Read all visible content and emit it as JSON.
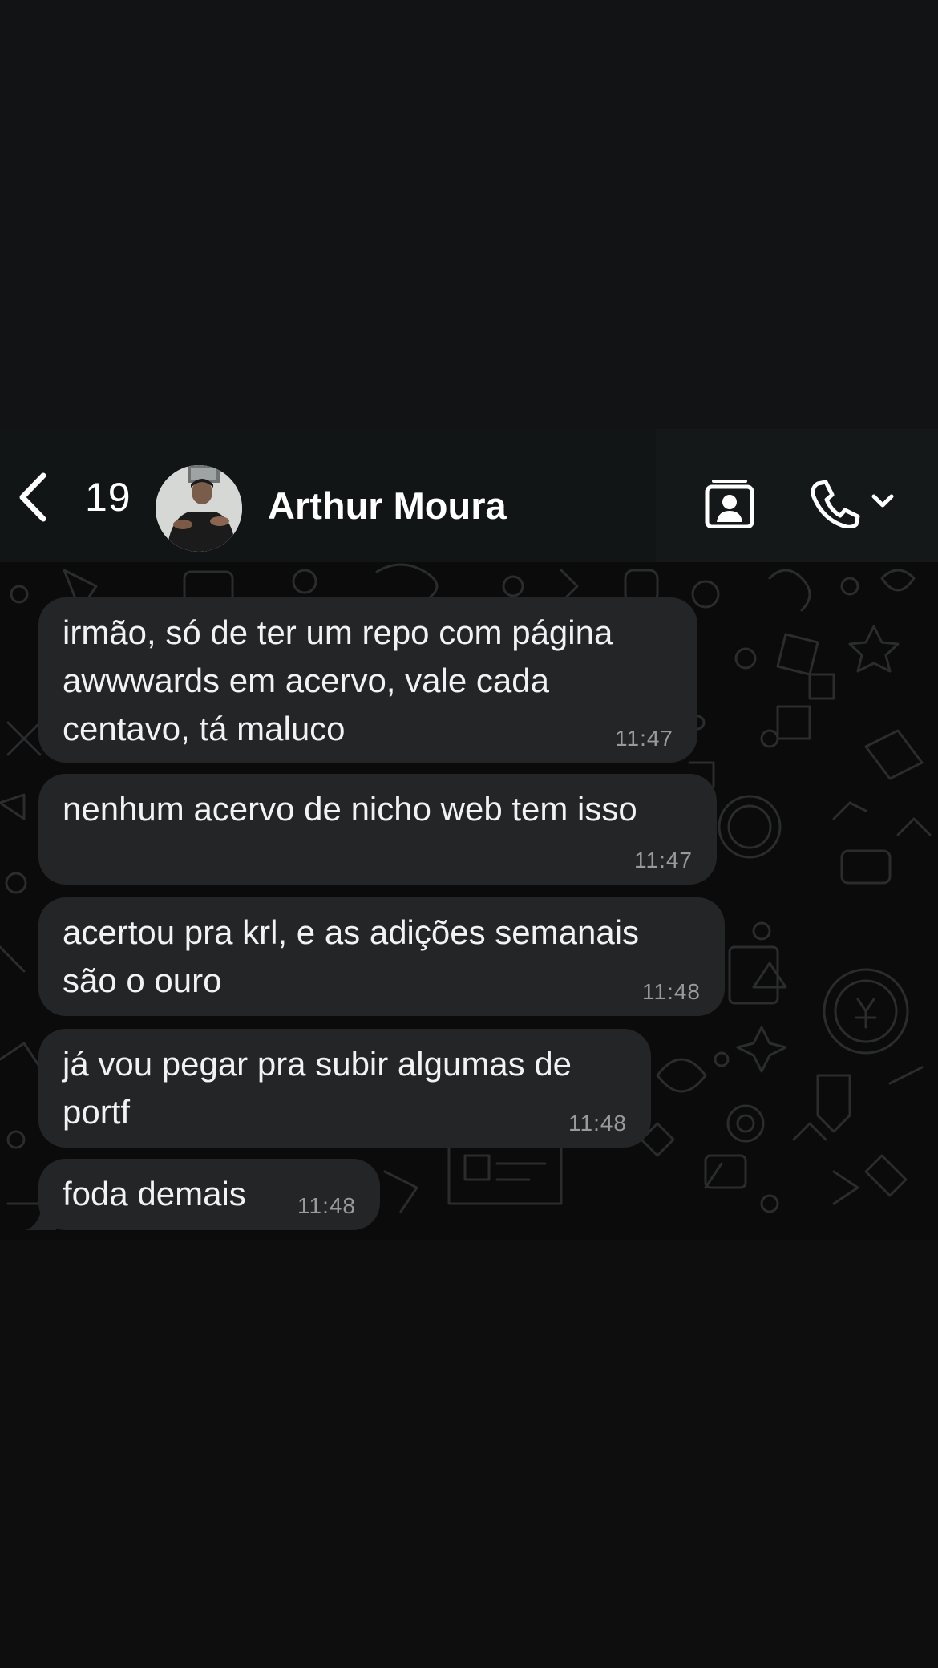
{
  "header": {
    "unread_count": "19",
    "contact_name": "Arthur Moura",
    "icons": {
      "back": "chevron-left-icon",
      "video": "contact-card-icon",
      "call": "phone-icon",
      "call_dropdown": "chevron-down-icon"
    }
  },
  "messages": [
    {
      "text": "irmão, só de ter um repo com página\nawwwards em acervo, vale cada\ncentavo, tá maluco",
      "time": "11:47"
    },
    {
      "text": "nenhum acervo de nicho web tem isso",
      "time": "11:47"
    },
    {
      "text": "acertou pra krl, e as adições semanais\nsão o ouro",
      "time": "11:48"
    },
    {
      "text": "já vou pegar pra subir algumas de\nportf",
      "time": "11:48"
    },
    {
      "text": "foda demais",
      "time": "11:48"
    }
  ],
  "colors": {
    "bubble_incoming": "#232526",
    "chat_background": "#0b0b0b",
    "header_background": "#121516",
    "text_primary": "#f2f2f2",
    "text_time": "#9a9a9a"
  }
}
